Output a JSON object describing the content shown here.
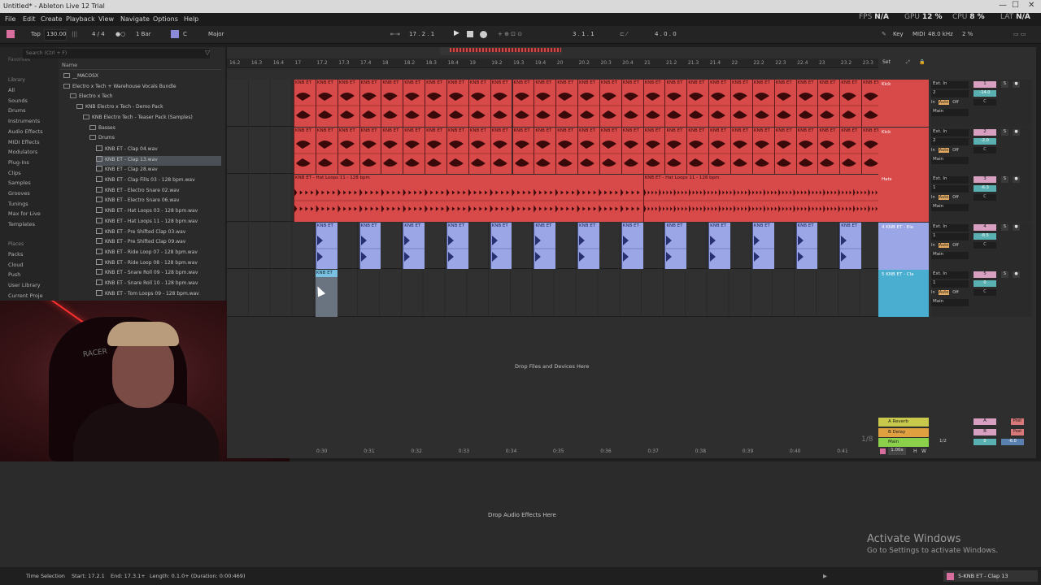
{
  "window": {
    "title": "Untitled* - Ableton Live 12 Trial",
    "minimize": "—",
    "maximize": "☐",
    "close": "✕"
  },
  "menu": {
    "items": [
      "File",
      "Edit",
      "Create",
      "Playback",
      "View",
      "Navigate",
      "Options",
      "Help"
    ],
    "fps_label": "FPS",
    "fps_value": "N/A",
    "gpu_label": "GPU",
    "gpu_value": "12 %",
    "cpu_label": "CPU",
    "cpu_value": "8 %",
    "lat_label": "LAT",
    "lat_value": "N/A"
  },
  "controlbar": {
    "tap": "Tap",
    "tempo": "130.00",
    "signature": "4 / 4",
    "quantize": "1 Bar",
    "key_root": "C",
    "scale": "Major",
    "position": "17 .  2 .  1",
    "loop_start": "3 .  1 .  1",
    "loop_length": "4 .  0 .  0",
    "key_label": "Key",
    "midi_label": "MIDI",
    "sample_rate": "48.0 kHz",
    "zoom": "2 %"
  },
  "browser": {
    "search_placeholder": "Search (Ctrl + F)",
    "favorites_label": "Favorites",
    "library_label": "Library",
    "library_items": [
      "All",
      "Sounds",
      "Drums",
      "Instruments",
      "Audio Effects",
      "MIDI Effects",
      "Modulators",
      "Plug-Ins",
      "Clips",
      "Samples",
      "Grooves",
      "Tunings",
      "Max for Live",
      "Templates"
    ],
    "places_label": "Places",
    "places_items": [
      "Packs",
      "Cloud",
      "Push",
      "User Library",
      "Current Proje"
    ],
    "column_name": "Name",
    "tree": [
      {
        "label": "__MACOSX",
        "indent": 0,
        "type": "folder",
        "selected": false
      },
      {
        "label": "Electro x Tech + Warehouse Vocals Bundle",
        "indent": 0,
        "type": "folder",
        "selected": false
      },
      {
        "label": "Electro x Tech",
        "indent": 1,
        "type": "folder",
        "selected": false
      },
      {
        "label": "KNB Electro x Tech - Demo Pack",
        "indent": 2,
        "type": "folder",
        "selected": false
      },
      {
        "label": "KNB Electro Tech - Teaser Pack (Samples)",
        "indent": 3,
        "type": "folder",
        "selected": false
      },
      {
        "label": "Basses",
        "indent": 4,
        "type": "folder",
        "selected": false
      },
      {
        "label": "Drums",
        "indent": 4,
        "type": "folder",
        "selected": false
      },
      {
        "label": "KNB ET - Clap 04.wav",
        "indent": 5,
        "type": "wav",
        "selected": false
      },
      {
        "label": "KNB ET - Clap 13.wav",
        "indent": 5,
        "type": "wav",
        "selected": true
      },
      {
        "label": "KNB ET - Clap 28.wav",
        "indent": 5,
        "type": "wav",
        "selected": false
      },
      {
        "label": "KNB ET - Clap Fills 03 - 128 bpm.wav",
        "indent": 5,
        "type": "wav",
        "selected": false
      },
      {
        "label": "KNB ET - Electro Snare 02.wav",
        "indent": 5,
        "type": "wav",
        "selected": false
      },
      {
        "label": "KNB ET - Electro Snare 06.wav",
        "indent": 5,
        "type": "wav",
        "selected": false
      },
      {
        "label": "KNB ET - Hat Loops 03 - 128 bpm.wav",
        "indent": 5,
        "type": "wav",
        "selected": false
      },
      {
        "label": "KNB ET - Hat Loops 11 - 128 bpm.wav",
        "indent": 5,
        "type": "wav",
        "selected": false
      },
      {
        "label": "KNB ET - Pre Shifted Clap 03.wav",
        "indent": 5,
        "type": "wav",
        "selected": false
      },
      {
        "label": "KNB ET - Pre Shifted Clap 09.wav",
        "indent": 5,
        "type": "wav",
        "selected": false
      },
      {
        "label": "KNB ET - Ride Loop 07 - 128 bpm.wav",
        "indent": 5,
        "type": "wav",
        "selected": false
      },
      {
        "label": "KNB ET - Ride Loop 08 - 128 bpm.wav",
        "indent": 5,
        "type": "wav",
        "selected": false
      },
      {
        "label": "KNB ET - Snare Roll 09 - 128 bpm.wav",
        "indent": 5,
        "type": "wav",
        "selected": false
      },
      {
        "label": "KNB ET - Snare Roll 10 - 128 bpm.wav",
        "indent": 5,
        "type": "wav",
        "selected": false
      },
      {
        "label": "KNB ET - Tom Loops 09 - 128 bpm.wav",
        "indent": 5,
        "type": "wav",
        "selected": false
      }
    ]
  },
  "webcam": {
    "chair_text": "RACER"
  },
  "arrangement": {
    "ruler": [
      "16.2",
      "16.3",
      "16.4",
      "17",
      "17.2",
      "17.3",
      "17.4",
      "18",
      "18.2",
      "18.3",
      "18.4",
      "19",
      "19.2",
      "19.3",
      "19.4",
      "20",
      "20.2",
      "20.3",
      "20.4",
      "21",
      "21.2",
      "21.3",
      "21.4",
      "22",
      "22.2",
      "22.3",
      "22.4",
      "23",
      "23.2",
      "23.3"
    ],
    "set_label": "Set",
    "tracks": [
      {
        "name": "Kick",
        "color": "#d84a4a",
        "number": "1",
        "input": "Ext. In",
        "channel": "2",
        "vol": "-14.0",
        "pan": "C",
        "output": "Main",
        "clip_label": "KNB ET",
        "kind": "kick"
      },
      {
        "name": "Kick",
        "color": "#d84a4a",
        "number": "2",
        "input": "Ext. In",
        "channel": "2",
        "vol": "-2.0",
        "pan": "C",
        "output": "Main",
        "clip_label": "KNB ET",
        "kind": "kick"
      },
      {
        "name": "Hats",
        "color": "#d84a4a",
        "number": "3",
        "input": "Ext. In",
        "channel": "1",
        "vol": "-6.3",
        "pan": "C",
        "output": "Main",
        "clip_label": "KNB ET - Hat Loops 11 - 128 bpm",
        "kind": "hats"
      },
      {
        "name": "4 KNB ET - Ele",
        "color": "#9aa6e6",
        "number": "4",
        "input": "Ext. In",
        "channel": "1",
        "vol": "-8.5",
        "pan": "C",
        "output": "Main",
        "clip_label": "KNB ET",
        "kind": "snare"
      },
      {
        "name": "5 KNB ET - Cla",
        "color": "#4aaed0",
        "number": "5",
        "input": "Ext. In",
        "channel": "1",
        "vol": "0",
        "pan": "C",
        "output": "Main",
        "clip_label": "KNB ET",
        "kind": "clap"
      }
    ],
    "io_in": "In",
    "io_auto": "Auto",
    "io_off": "Off",
    "solo": "S",
    "drop_files": "Drop Files and Devices Here",
    "returns": [
      {
        "name": "A Reverb",
        "color": "#c8c84a",
        "letter": "A"
      },
      {
        "name": "B Delay",
        "color": "#e0a040",
        "letter": "B"
      },
      {
        "name": "Main",
        "color": "#8ad04a",
        "letter": ""
      }
    ],
    "main_out": "1/2",
    "main_vol": "0",
    "main_post": "-6.0",
    "post_label": "Post",
    "grid_label": "1/8",
    "speed": "1.00x",
    "h_btn": "H",
    "w_btn": "W",
    "timecodes": [
      "0:30",
      "0:31",
      "0:32",
      "0:33",
      "0:34",
      "0:35",
      "0:36",
      "0:37",
      "0:38",
      "0:39",
      "0:40",
      "0:41"
    ]
  },
  "device": {
    "drop_audio": "Drop Audio Effects Here"
  },
  "watermark": {
    "title": "Activate Windows",
    "subtitle": "Go to Settings to activate Windows."
  },
  "status": {
    "selection": "Time Selection",
    "start": "Start: 17.2.1",
    "end": "End: 17.3.1+",
    "length": "Length: 0.1.0+ (Duration: 0:00:469)",
    "track": "5-KNB ET - Clap 13"
  }
}
